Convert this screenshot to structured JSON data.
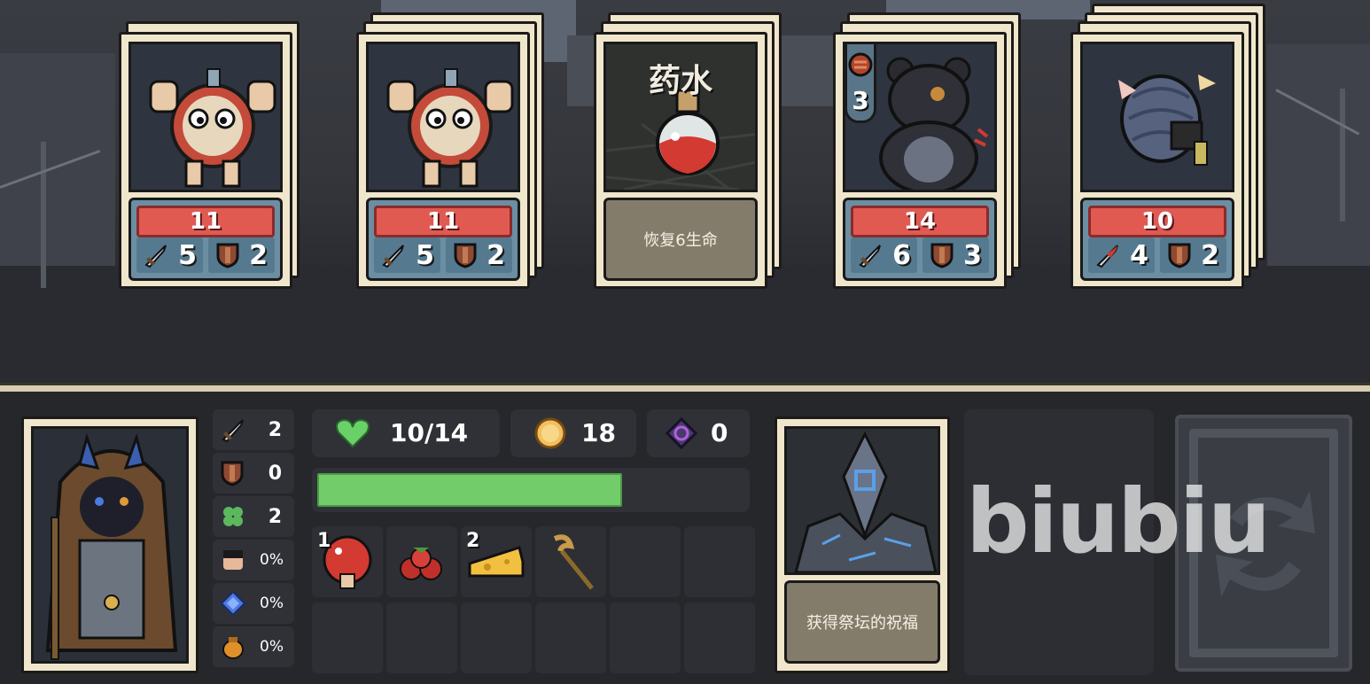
{
  "cards": [
    {
      "type": "enemy",
      "hp": "11",
      "attack": "5",
      "defense": "2",
      "creature": "clockwork-doll"
    },
    {
      "type": "enemy",
      "hp": "11",
      "attack": "5",
      "defense": "2",
      "creature": "clockwork-doll"
    },
    {
      "type": "item",
      "title": "药水",
      "description": "恢复6生命",
      "item": "red-potion"
    },
    {
      "type": "enemy",
      "hp": "14",
      "attack": "6",
      "defense": "3",
      "creature": "shadow-bear",
      "tag_value": "3"
    },
    {
      "type": "enemy",
      "hp": "10",
      "attack": "4",
      "defense": "2",
      "creature": "hermit-snail"
    }
  ],
  "player": {
    "attack": "2",
    "defense": "0",
    "luck": "2",
    "stat_pct_1": "0%",
    "stat_pct_2": "0%",
    "stat_pct_3": "0%",
    "health": "10/14",
    "health_fraction": 0.714,
    "gold": "18",
    "crystals": "0"
  },
  "inventory": [
    {
      "name": "mushroom",
      "count": "1"
    },
    {
      "name": "berries",
      "count": ""
    },
    {
      "name": "cheese",
      "count": "2"
    },
    {
      "name": "staff",
      "count": ""
    }
  ],
  "altar_card": {
    "description": "获得祭坛的祝福"
  },
  "watermark": "biubiu",
  "colors": {
    "hp": "#e05a52",
    "xp": "#72cc6a",
    "card": "#efe6cc",
    "stats": "#6b8ea3"
  }
}
